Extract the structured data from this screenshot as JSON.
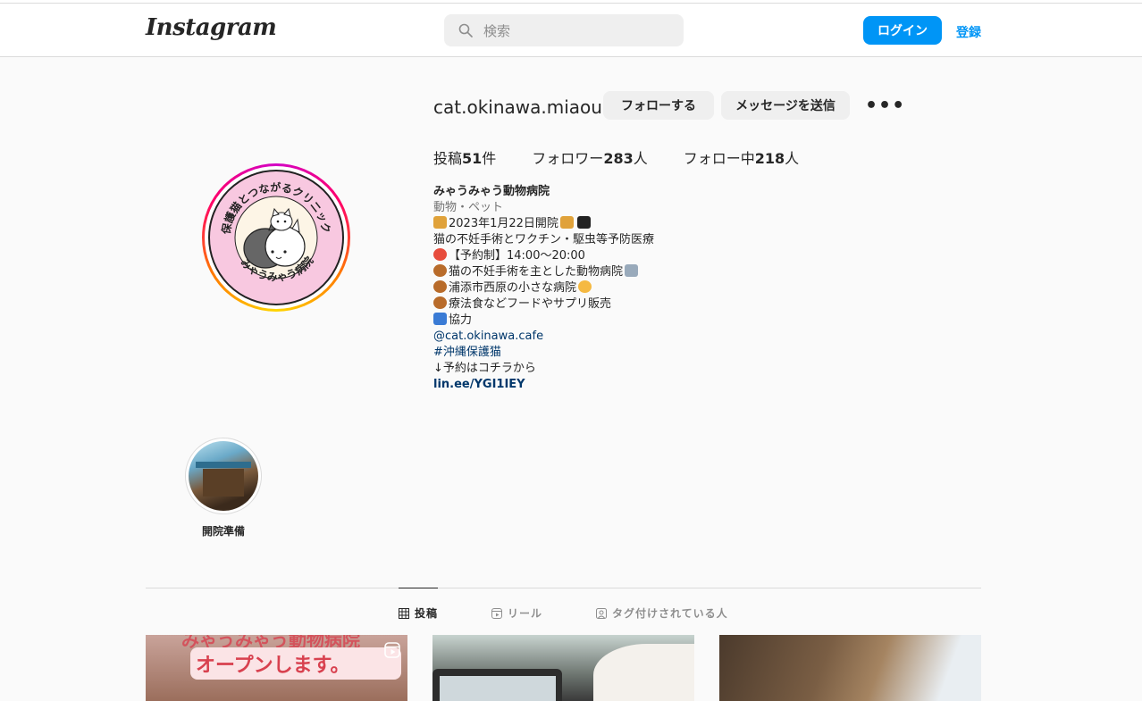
{
  "header": {
    "logo": "Instagram",
    "search_placeholder": "検索",
    "login_label": "ログイン",
    "signup_label": "登録"
  },
  "profile": {
    "username": "cat.okinawa.miaou",
    "follow_label": "フォローする",
    "message_label": "メッセージを送信",
    "more_label": "•••",
    "stats": {
      "posts_label": "投稿",
      "posts_value": "51",
      "posts_unit": "件",
      "followers_label": "フォロワー",
      "followers_value": "283",
      "followers_unit": "人",
      "following_label": "フォロー中",
      "following_value": "218",
      "following_unit": "人"
    },
    "avatar_text_top": "保護猫とつながるクリニック",
    "avatar_text_bottom": "みゃうみゃう病院",
    "bio": {
      "name": "みゃうみゃう動物病院",
      "category": "動物・ペット",
      "lines": [
        "2023年1月22日開院",
        "猫の不妊手術とワクチン・駆虫等予防医療",
        "【予約制】14:00〜20:00",
        "猫の不妊手術を主とした動物病院",
        "浦添市西原の小さな病院",
        "療法食などフードやサプリ販売",
        "協力"
      ],
      "mention": "@cat.okinawa.cafe",
      "hashtag": "#沖縄保護猫",
      "reservation": "↓予約はコチラから",
      "link": "lin.ee/YGI1IEY"
    }
  },
  "highlights": [
    {
      "label": "開院準備"
    }
  ],
  "tabs": [
    {
      "label": "投稿",
      "icon": "grid-icon"
    },
    {
      "label": "リール",
      "icon": "reels-icon"
    },
    {
      "label": "タグ付けされている人",
      "icon": "tagged-icon"
    }
  ],
  "posts": [
    {
      "text": "オープンします。",
      "text_top": "みゃうみゃう動物病院"
    },
    {},
    {}
  ],
  "colors": {
    "accent": "#0095f6",
    "link": "#00376b",
    "text": "#262626",
    "muted": "#737373"
  }
}
